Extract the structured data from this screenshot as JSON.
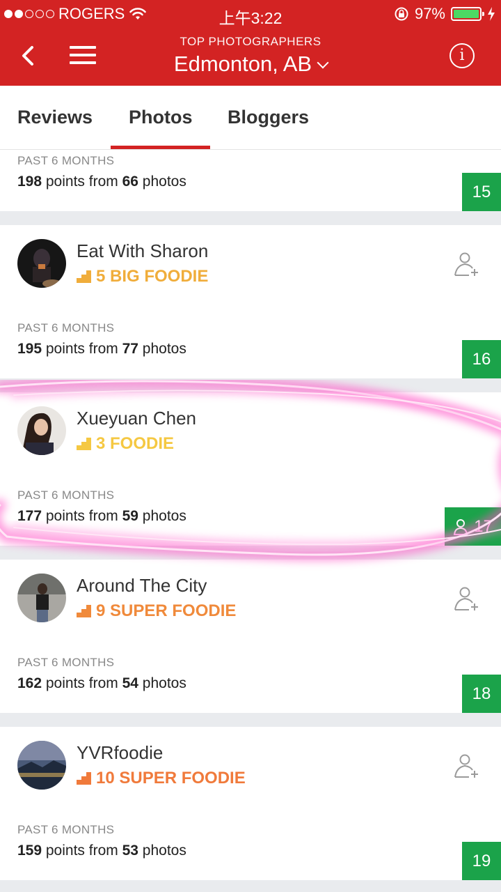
{
  "status_bar": {
    "carrier": "ROGERS",
    "time": "上午3:22",
    "battery": "97%"
  },
  "nav": {
    "subtitle": "TOP PHOTOGRAPHERS",
    "title": "Edmonton, AB"
  },
  "tabs": [
    {
      "label": "Reviews",
      "active": false
    },
    {
      "label": "Photos",
      "active": true
    },
    {
      "label": "Bloggers",
      "active": false
    }
  ],
  "entries": [
    {
      "name": "",
      "level": "",
      "period": "PAST 6 MONTHS",
      "points": "198",
      "points_text": " points from ",
      "photos": "66",
      "photos_text": " photos",
      "rank": "15"
    },
    {
      "name": "Eat With Sharon",
      "level": "5 BIG FOODIE",
      "level_color": "#f0ad3b",
      "period": "PAST 6 MONTHS",
      "points": "195",
      "points_text": " points from ",
      "photos": "77",
      "photos_text": " photos",
      "rank": "16"
    },
    {
      "name": "Xueyuan Chen",
      "level": "3 FOODIE",
      "level_color": "#f5c842",
      "period": "PAST 6 MONTHS",
      "points": "177",
      "points_text": " points from ",
      "photos": "59",
      "photos_text": " photos",
      "rank": "17",
      "rank_icon": "user-icon"
    },
    {
      "name": "Around The City",
      "level": "9 SUPER FOODIE",
      "level_color": "#f08a3b",
      "period": "PAST 6 MONTHS",
      "points": "162",
      "points_text": " points from ",
      "photos": "54",
      "photos_text": " photos",
      "rank": "18"
    },
    {
      "name": "YVRfoodie",
      "level": "10 SUPER FOODIE",
      "level_color": "#f07a3b",
      "period": "PAST 6 MONTHS",
      "points": "159",
      "points_text": " points from ",
      "photos": "53",
      "photos_text": " photos",
      "rank": "19"
    }
  ],
  "colors": {
    "brand_red": "#d32323",
    "rank_green": "#1ba34a",
    "highlight_pink": "#ff4fc4"
  }
}
